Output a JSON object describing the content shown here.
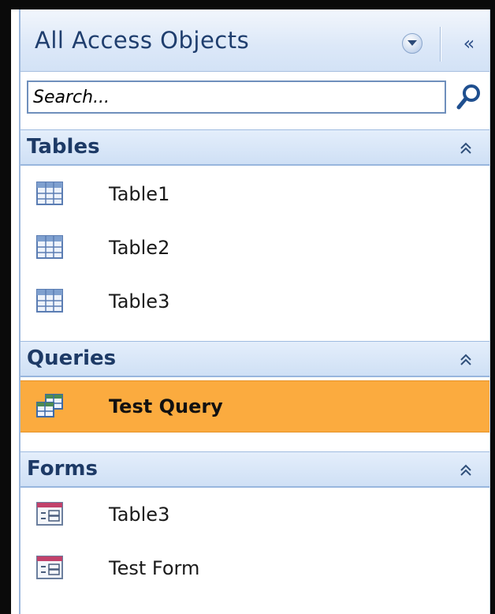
{
  "pane": {
    "title": "All Access Objects",
    "collapse_glyph": "«"
  },
  "search": {
    "placeholder": "Search..."
  },
  "groups": [
    {
      "label": "Tables",
      "items": [
        {
          "label": "Table1",
          "icon": "table-icon"
        },
        {
          "label": "Table2",
          "icon": "table-icon"
        },
        {
          "label": "Table3",
          "icon": "table-icon"
        }
      ]
    },
    {
      "label": "Queries",
      "items": [
        {
          "label": "Test Query",
          "icon": "query-icon",
          "selected": true
        }
      ]
    },
    {
      "label": "Forms",
      "items": [
        {
          "label": "Table3",
          "icon": "form-icon"
        },
        {
          "label": "Test Form",
          "icon": "form-icon"
        }
      ]
    }
  ],
  "colors": {
    "selection": "#fbab3f",
    "header_text": "#1d3a66",
    "title_text": "#1f3e6e"
  }
}
